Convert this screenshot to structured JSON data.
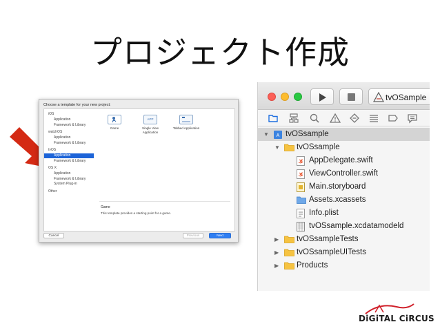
{
  "slide": {
    "title": "プロジェクト作成"
  },
  "template_dialog": {
    "header": "Choose a template for your new project:",
    "categories": [
      {
        "heading": "iOS",
        "items": [
          "Application",
          "Framework & Library"
        ]
      },
      {
        "heading": "watchOS",
        "items": [
          "Application",
          "Framework & Library"
        ]
      },
      {
        "heading": "tvOS",
        "items": [
          "Application",
          "Framework & Library"
        ]
      },
      {
        "heading": "OS X",
        "items": [
          "Application",
          "Framework & Library",
          "System Plug-in"
        ]
      },
      {
        "heading": "Other",
        "items": []
      }
    ],
    "selected_category": "tvOS / Application",
    "templates": [
      {
        "label": "Game",
        "icon_text": ""
      },
      {
        "label": "Single View Application",
        "icon_text": "APP"
      },
      {
        "label": "Tabbed Application",
        "icon_text": ""
      }
    ],
    "description_title": "Game",
    "description_text": "This template provides a starting point for a game.",
    "buttons": {
      "cancel": "Cancel",
      "previous": "Previous",
      "next": "Next"
    }
  },
  "xcode": {
    "scheme": "tvOSample",
    "navigator_tabs": [
      "folder-icon",
      "hierarchy-icon",
      "search-icon",
      "warning-icon",
      "test-diamond-icon",
      "debug-list-icon",
      "breakpoint-icon",
      "report-icon"
    ],
    "tree": [
      {
        "label": "tvOSsample",
        "level": 0,
        "type": "project",
        "disclosure": "open",
        "selected": true
      },
      {
        "label": "tvOSsample",
        "level": 1,
        "type": "folder",
        "disclosure": "open"
      },
      {
        "label": "AppDelegate.swift",
        "level": 2,
        "type": "swift"
      },
      {
        "label": "ViewController.swift",
        "level": 2,
        "type": "swift"
      },
      {
        "label": "Main.storyboard",
        "level": 2,
        "type": "storyboard"
      },
      {
        "label": "Assets.xcassets",
        "level": 2,
        "type": "assets"
      },
      {
        "label": "Info.plist",
        "level": 2,
        "type": "plist"
      },
      {
        "label": "tvOSsample.xcdatamodeld",
        "level": 2,
        "type": "datamodel"
      },
      {
        "label": "tvOSsampleTests",
        "level": 1,
        "type": "folder",
        "disclosure": "closed"
      },
      {
        "label": "tvOSsampleUITests",
        "level": 1,
        "type": "folder",
        "disclosure": "closed"
      },
      {
        "label": "Products",
        "level": 1,
        "type": "folder",
        "disclosure": "closed"
      }
    ],
    "colors": {
      "selection": "#d4d4d4",
      "folder": "#f6c341",
      "swift": "#e8542e"
    }
  },
  "logo": {
    "text": "DiGiTAL CiRCUS",
    "accent": "#d0202a"
  },
  "accents": {
    "arrow": "#d42a14",
    "dialog_selected": "#1d64d8",
    "next_button": "#2f7ef2"
  }
}
